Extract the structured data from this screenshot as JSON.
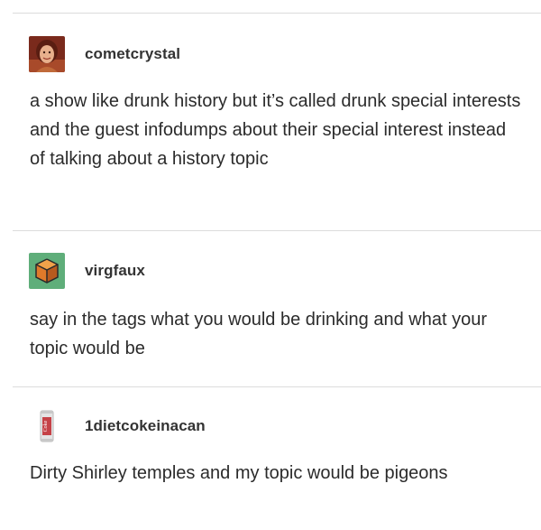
{
  "posts": [
    {
      "username": "cometcrystal",
      "avatar_icon": "person-photo-avatar-icon",
      "text": "a show like drunk history but it’s called drunk special interests and the guest infodumps about their special interest instead of talking about a history topic"
    },
    {
      "username": "virgfaux",
      "avatar_icon": "cube-box-avatar-icon",
      "text": "say in the tags what you would be drinking and what your topic would be"
    },
    {
      "username": "1dietcokeinacan",
      "avatar_icon": "diet-coke-can-avatar-icon",
      "can_label": "Coke",
      "text": "Dirty Shirley temples and my topic would be pigeons"
    }
  ],
  "colors": {
    "background": "#ffffff",
    "divider": "#dcdcdc",
    "text": "#2b2b2b",
    "username": "#333333"
  }
}
